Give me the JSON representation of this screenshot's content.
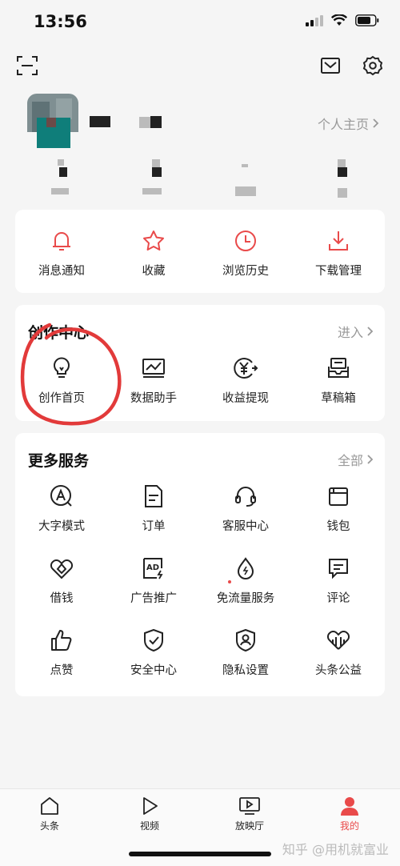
{
  "status_bar": {
    "time": "13:56"
  },
  "profile": {
    "homepage_label": "个人主页"
  },
  "quick_actions": [
    {
      "label": "消息通知",
      "icon": "bell-icon"
    },
    {
      "label": "收藏",
      "icon": "star-icon"
    },
    {
      "label": "浏览历史",
      "icon": "clock-icon"
    },
    {
      "label": "下载管理",
      "icon": "download-icon"
    }
  ],
  "creation_center": {
    "title": "创作中心",
    "more": "进入",
    "items": [
      {
        "label": "创作首页",
        "icon": "lightbulb-icon"
      },
      {
        "label": "数据助手",
        "icon": "chart-monitor-icon"
      },
      {
        "label": "收益提现",
        "icon": "yuan-coin-icon"
      },
      {
        "label": "草稿箱",
        "icon": "draft-box-icon"
      }
    ]
  },
  "more_services": {
    "title": "更多服务",
    "more": "全部",
    "items": [
      {
        "label": "大字模式",
        "icon": "large-font-icon"
      },
      {
        "label": "订单",
        "icon": "document-icon"
      },
      {
        "label": "客服中心",
        "icon": "headset-icon"
      },
      {
        "label": "钱包",
        "icon": "wallet-icon"
      },
      {
        "label": "借钱",
        "icon": "loan-icon"
      },
      {
        "label": "广告推广",
        "icon": "ad-icon"
      },
      {
        "label": "免流量服务",
        "icon": "data-drop-icon"
      },
      {
        "label": "评论",
        "icon": "comment-icon"
      },
      {
        "label": "点赞",
        "icon": "thumbs-up-icon"
      },
      {
        "label": "安全中心",
        "icon": "shield-check-icon"
      },
      {
        "label": "隐私设置",
        "icon": "privacy-shield-icon"
      },
      {
        "label": "头条公益",
        "icon": "charity-icon"
      }
    ]
  },
  "tabbar": [
    {
      "label": "头条",
      "icon": "home-icon",
      "active": false
    },
    {
      "label": "视频",
      "icon": "play-icon",
      "active": false
    },
    {
      "label": "放映厅",
      "icon": "cinema-icon",
      "active": false
    },
    {
      "label": "我的",
      "icon": "person-icon",
      "active": true
    }
  ],
  "watermark": "知乎 @用机就富业",
  "colors": {
    "accent": "#e94a4a",
    "annotation_circle": "#e23a3a"
  }
}
